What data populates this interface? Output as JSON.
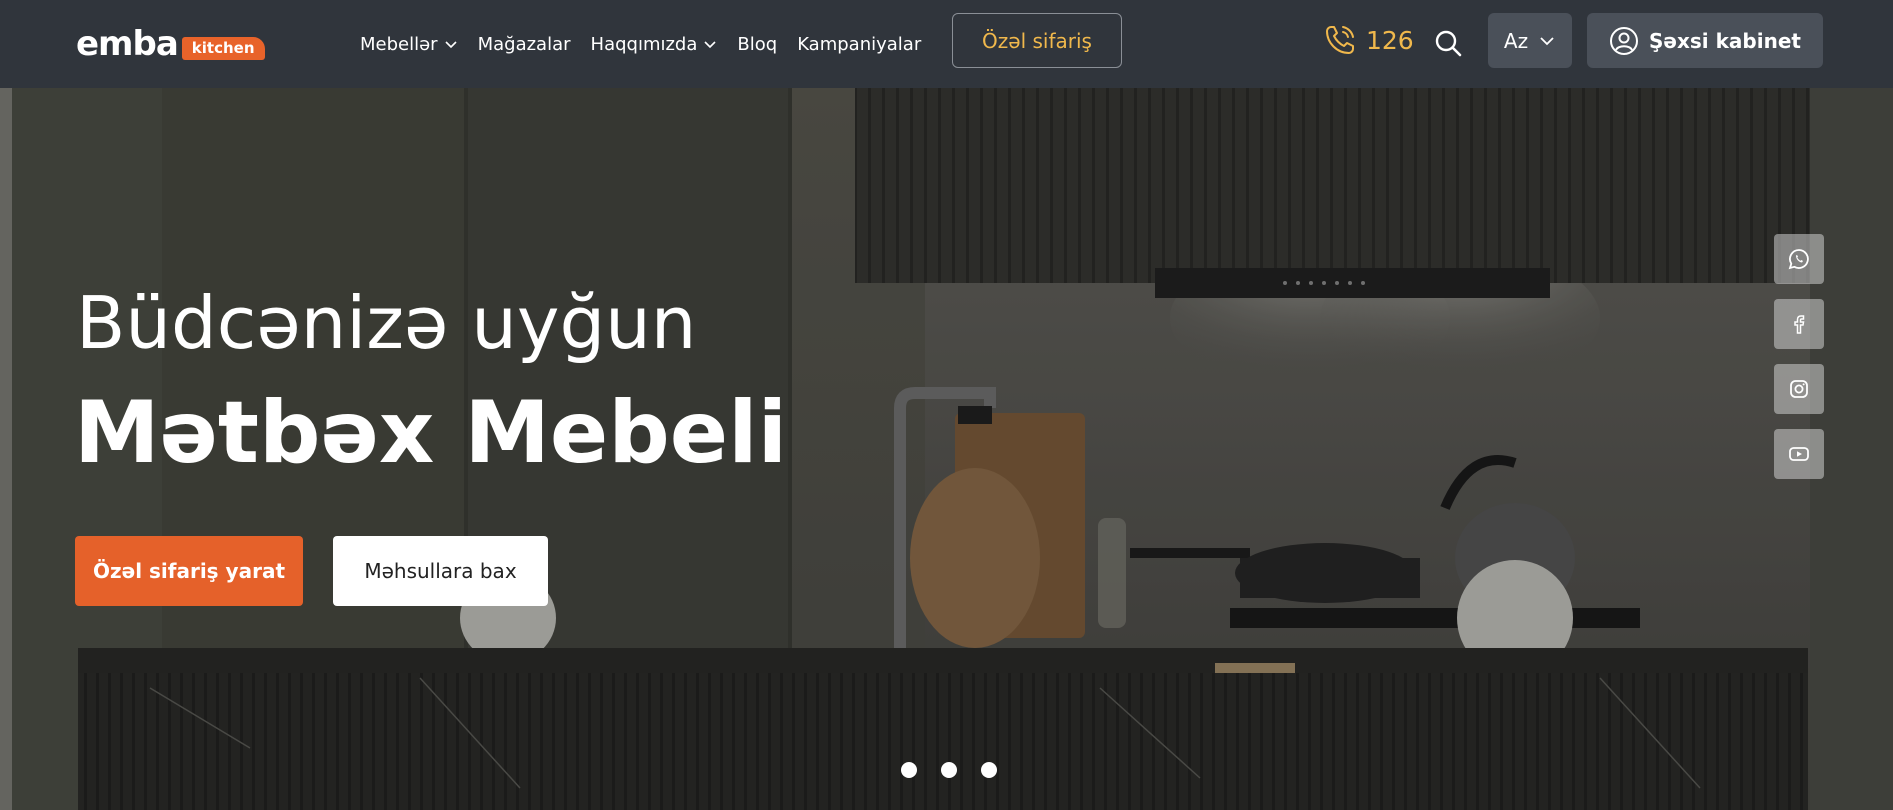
{
  "header": {
    "logo_word": "emba",
    "logo_tag": "kitchen",
    "nav": [
      {
        "label": "Mebellər",
        "has_dropdown": true
      },
      {
        "label": "Mağazalar",
        "has_dropdown": false
      },
      {
        "label": "Haqqımızda",
        "has_dropdown": true
      },
      {
        "label": "Bloq",
        "has_dropdown": false
      },
      {
        "label": "Kampaniyalar",
        "has_dropdown": false
      }
    ],
    "special_order_label": "Özəl sifariş",
    "phone_number": "126",
    "language": "Az",
    "cabinet_label": "Şəxsi kabinet",
    "icons": {
      "phone": "phone-icon",
      "search": "search-icon",
      "user": "user-circle-icon",
      "chevron": "chevron-down-icon"
    }
  },
  "hero": {
    "line1": "Büdcənizə uyğun",
    "line2": "Mətbəx Mebeli",
    "primary_cta": "Özəl sifariş yarat",
    "secondary_cta": "Məhsullara bax",
    "slides_count": 3,
    "social": [
      {
        "name": "whatsapp-icon"
      },
      {
        "name": "facebook-icon"
      },
      {
        "name": "instagram-icon"
      },
      {
        "name": "youtube-icon"
      }
    ]
  },
  "colors": {
    "header_bg": "#30353c",
    "accent_orange": "#e5612a",
    "accent_gold": "#f0b84c",
    "button_dark": "#4a5059"
  }
}
